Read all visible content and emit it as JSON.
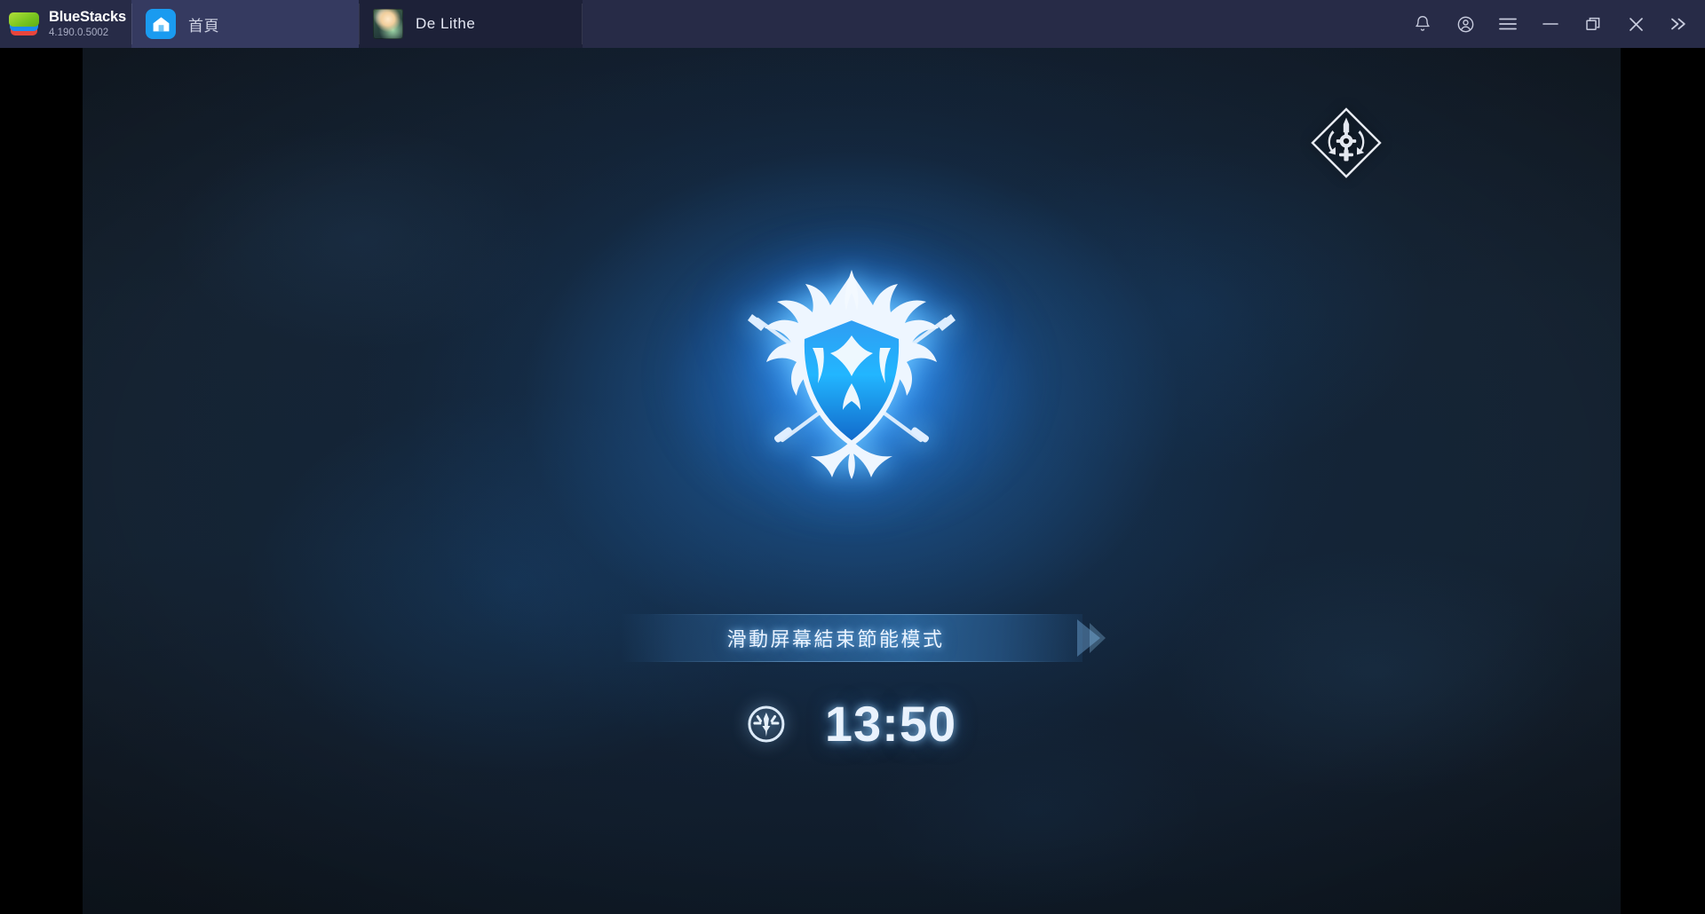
{
  "window": {
    "brand_name": "BlueStacks",
    "version": "4.190.0.5002"
  },
  "tabs": [
    {
      "id": "home",
      "label": "首頁",
      "icon": "home-icon",
      "active": false
    },
    {
      "id": "de-lithe",
      "label": "De Lithe",
      "icon": "game-avatar",
      "active": true
    }
  ],
  "window_controls": [
    {
      "id": "notifications",
      "icon": "bell-icon",
      "tooltip": ""
    },
    {
      "id": "account",
      "icon": "account-circle-icon",
      "tooltip": ""
    },
    {
      "id": "menu",
      "icon": "hamburger-menu-icon",
      "tooltip": ""
    },
    {
      "id": "minimize",
      "icon": "minimize-icon",
      "tooltip": ""
    },
    {
      "id": "maximize",
      "icon": "restore-window-icon",
      "tooltip": ""
    },
    {
      "id": "close",
      "icon": "close-icon",
      "tooltip": ""
    },
    {
      "id": "expand-sidebar",
      "icon": "double-chevron-right-icon",
      "tooltip": ""
    }
  ],
  "game": {
    "title": "De Lithe",
    "power_save_banner": "滑動屏幕結束節能模式",
    "clock": "13:50",
    "clock_icon": "game-emblem-icon",
    "crest_icon": "heraldic-crest-icon",
    "badge_icon": "gear-sync-diamond-icon"
  },
  "colors": {
    "titlebar_bg": "#272b47",
    "tab_inactive_bg": "#353a60",
    "tab_active_bg": "#1d2138",
    "brand_text": "#ffffff",
    "version_text": "#a9adc4",
    "tab_label": "#cfd3e4",
    "home_icon_bg": "#1a9bf0",
    "letterbox": "#000000",
    "game_glow_blue": "#2a84d6",
    "game_bg_dark": "#131c27",
    "banner_text": "#eaf3ff",
    "clock_text": "#e9f2fd"
  }
}
